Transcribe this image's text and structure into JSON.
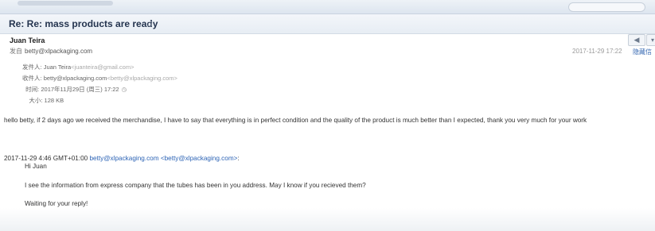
{
  "email": {
    "subject": "Re: Re: mass products are ready",
    "sender_name": "Juan Teira",
    "sender_label": "发自",
    "sender_account": "betty@xlpackaging.com",
    "date": "2017-11-29 17:22",
    "date_link": "隐藏信",
    "details": {
      "from_label": "发件人:",
      "from_name": "Juan Teira",
      "from_addr": "<juanteira@gmail.com>",
      "to_label": "收件人:",
      "to_name": "betty@xlpackaging.com",
      "to_addr": "<betty@xlpackaging.com>",
      "time_label": "时间:",
      "time_value": "2017年11月29日 (周三) 17:22",
      "size_label": "大小:",
      "size_value": "128 KB"
    },
    "body": "hello betty, if 2 days ago we received the merchandise, I have to say that everything is in perfect condition and the quality of the product is much better than I expected, thank you very much for your work",
    "quote_header": {
      "prefix": "2017-11-29 4:46 GMT+01:00",
      "link": "betty@xlpackaging.com",
      "addr": "<betty@xlpackaging.com>",
      "suffix": ":"
    },
    "quoted_lines": [
      "Hi Juan",
      "I see the information from express company that the tubes has been in you address. May I know if you recieved them?",
      "Waiting for your reply!"
    ]
  },
  "icons": {
    "reply": "reply-arrow-icon",
    "more": "chevron-down-icon",
    "star": "star-icon",
    "clock": "clock-icon"
  },
  "colors": {
    "link": "#2c63b5",
    "subject": "#24344f"
  }
}
